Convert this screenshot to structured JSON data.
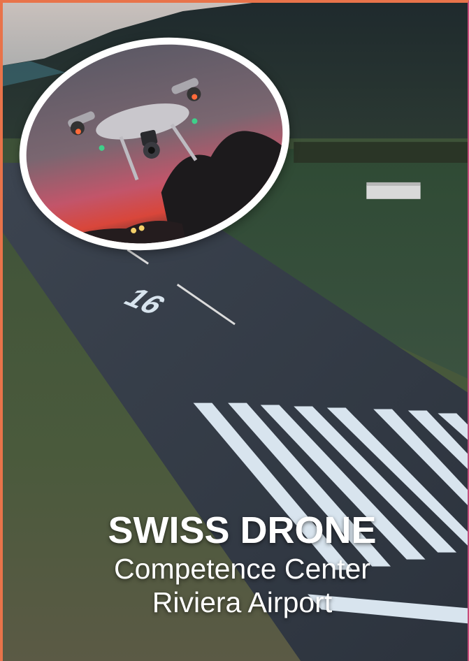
{
  "cover": {
    "title": "SWISS DRONE",
    "subtitle_line1": "Competence Center",
    "subtitle_line2": "Riviera Airport",
    "runway_number": "16"
  },
  "images": {
    "background": "airfield-runway-photo",
    "inset": "drone-at-sunset-photo"
  },
  "colors": {
    "border_left": "#e8734a",
    "border_right": "#c94a7a",
    "title_text": "#ffffff"
  }
}
